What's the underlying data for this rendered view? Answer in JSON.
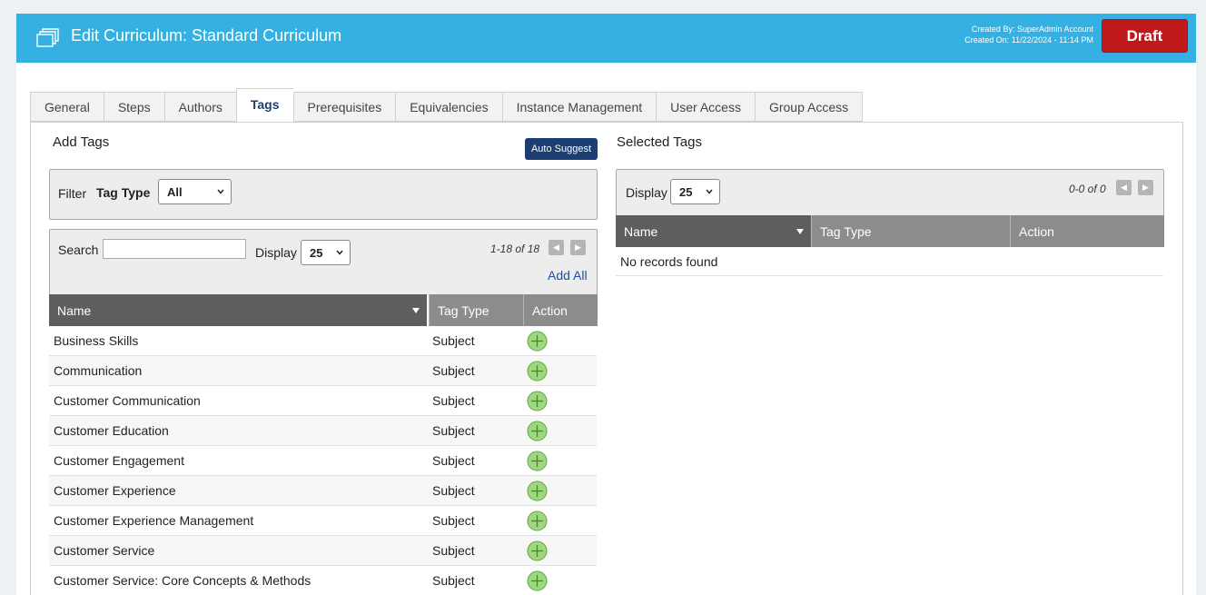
{
  "header": {
    "title": "Edit Curriculum: Standard Curriculum",
    "created_by": "Created By: SuperAdmin Account",
    "created_on": "Created On: 11/22/2024 - 11:14 PM",
    "status_button": "Draft",
    "bg_color": "#35b0e2",
    "status_color": "#c0181d"
  },
  "tabs": [
    {
      "label": "General"
    },
    {
      "label": "Steps"
    },
    {
      "label": "Authors"
    },
    {
      "label": "Tags",
      "active": true
    },
    {
      "label": "Prerequisites"
    },
    {
      "label": "Equivalencies"
    },
    {
      "label": "Instance Management"
    },
    {
      "label": "User Access"
    },
    {
      "label": "Group Access"
    }
  ],
  "add_tags": {
    "title": "Add Tags",
    "auto_suggest": "Auto Suggest",
    "filter_label": "Filter",
    "tag_type_label": "Tag Type",
    "tag_type_value": "All",
    "search_label": "Search",
    "search_value": "",
    "display_label": "Display",
    "display_value": "25",
    "pager": "1-18 of 18",
    "add_all": "Add All",
    "columns": [
      "Name",
      "Tag Type",
      "Action"
    ],
    "rows": [
      {
        "name": "Business Skills",
        "type": "Subject"
      },
      {
        "name": "Communication",
        "type": "Subject"
      },
      {
        "name": "Customer Communication",
        "type": "Subject"
      },
      {
        "name": "Customer Education",
        "type": "Subject"
      },
      {
        "name": "Customer Engagement",
        "type": "Subject"
      },
      {
        "name": "Customer Experience",
        "type": "Subject"
      },
      {
        "name": "Customer Experience Management",
        "type": "Subject"
      },
      {
        "name": "Customer Service",
        "type": "Subject"
      },
      {
        "name": "Customer Service: Core Concepts & Methods",
        "type": "Subject"
      }
    ]
  },
  "selected_tags": {
    "title": "Selected Tags",
    "display_label": "Display",
    "display_value": "25",
    "pager": "0-0 of 0",
    "columns": [
      "Name",
      "Tag Type",
      "Action"
    ],
    "empty_text": "No records found"
  },
  "icons": {
    "logo": "stacked-pages-icon",
    "add": "plus-circle-icon",
    "prev": "prev-page-icon",
    "next": "next-page-icon",
    "sort": "sort-down-icon"
  }
}
